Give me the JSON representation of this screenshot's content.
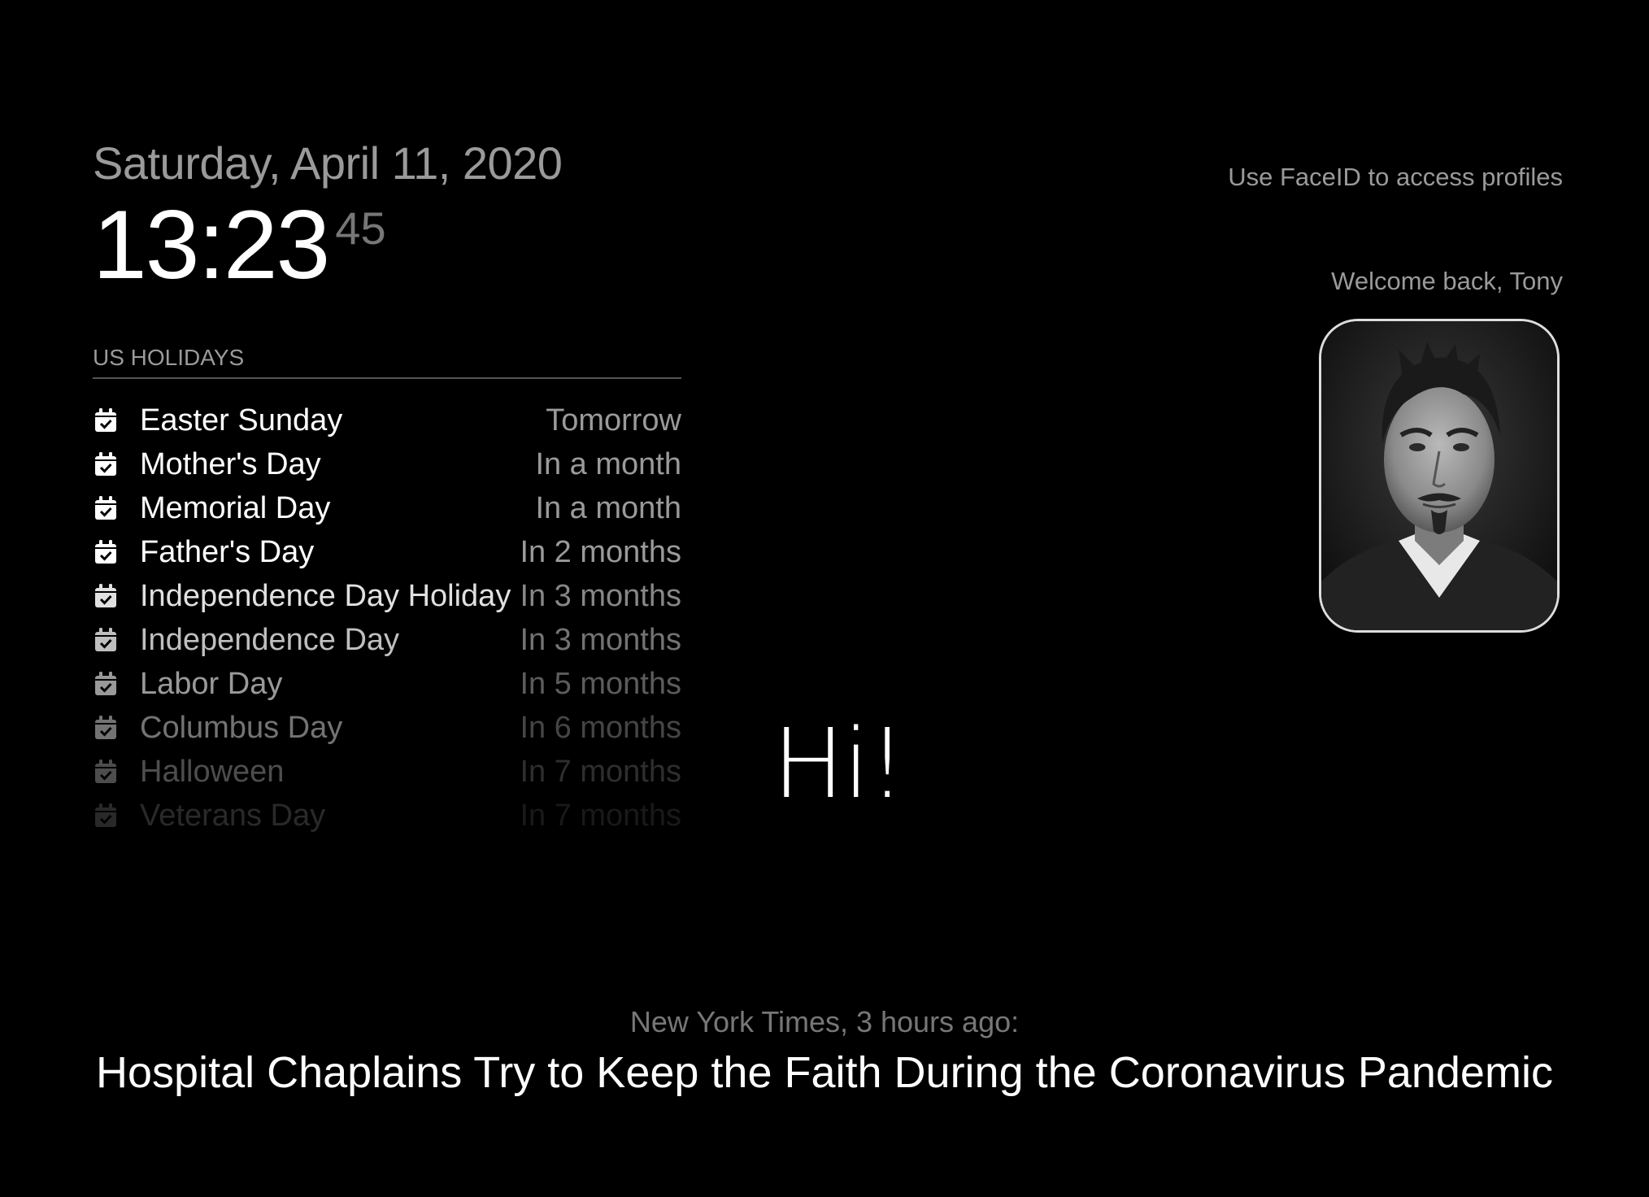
{
  "clock": {
    "date": "Saturday, April 11, 2020",
    "time": "13:23",
    "seconds": "45"
  },
  "calendar": {
    "header": "US HOLIDAYS",
    "icon": "calendar-check-icon",
    "events": [
      {
        "title": "Easter Sunday",
        "when": "Tomorrow",
        "opacity": 1.0
      },
      {
        "title": "Mother's Day",
        "when": "In a month",
        "opacity": 1.0
      },
      {
        "title": "Memorial Day",
        "when": "In a month",
        "opacity": 1.0
      },
      {
        "title": "Father's Day",
        "when": "In 2 months",
        "opacity": 1.0
      },
      {
        "title": "Independence Day Holiday",
        "when": "In 3 months",
        "opacity": 0.88
      },
      {
        "title": "Independence Day",
        "when": "In 3 months",
        "opacity": 0.75
      },
      {
        "title": "Labor Day",
        "when": "In 5 months",
        "opacity": 0.6
      },
      {
        "title": "Columbus Day",
        "when": "In 6 months",
        "opacity": 0.45
      },
      {
        "title": "Halloween",
        "when": "In 7 months",
        "opacity": 0.3
      },
      {
        "title": "Veterans Day",
        "when": "In 7 months",
        "opacity": 0.16
      }
    ]
  },
  "face": {
    "hint": "Use FaceID to access profiles",
    "welcome": "Welcome back, Tony"
  },
  "compliment": "Hi!",
  "news": {
    "source": "New York Times, 3 hours ago:",
    "headline": "Hospital Chaplains Try to Keep the Faith During the Coronavirus Pandemic"
  },
  "colors": {
    "background": "#000000",
    "bright": "#ffffff",
    "dimmed": "#9a9a9a"
  }
}
